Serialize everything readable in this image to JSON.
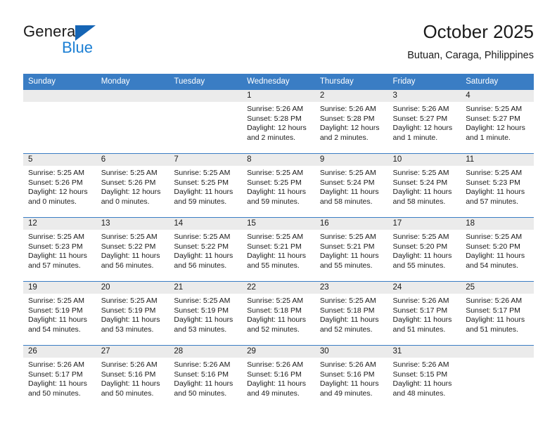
{
  "brand": {
    "line1": "General",
    "line2": "Blue",
    "triangle_color": "#1565b5",
    "blue_color": "#1b7fd4"
  },
  "header": {
    "title": "October 2025",
    "subtitle": "Butuan, Caraga, Philippines"
  },
  "theme": {
    "header_bg": "#3a7dc4",
    "daynum_bg": "#ebebeb",
    "text": "#1a1a1a"
  },
  "calendar": {
    "weekday_headers": [
      "Sunday",
      "Monday",
      "Tuesday",
      "Wednesday",
      "Thursday",
      "Friday",
      "Saturday"
    ],
    "weeks": [
      [
        {
          "day": "",
          "sunrise": "",
          "sunset": "",
          "daylight1": "",
          "daylight2": ""
        },
        {
          "day": "",
          "sunrise": "",
          "sunset": "",
          "daylight1": "",
          "daylight2": ""
        },
        {
          "day": "",
          "sunrise": "",
          "sunset": "",
          "daylight1": "",
          "daylight2": ""
        },
        {
          "day": "1",
          "sunrise": "Sunrise: 5:26 AM",
          "sunset": "Sunset: 5:28 PM",
          "daylight1": "Daylight: 12 hours",
          "daylight2": "and 2 minutes."
        },
        {
          "day": "2",
          "sunrise": "Sunrise: 5:26 AM",
          "sunset": "Sunset: 5:28 PM",
          "daylight1": "Daylight: 12 hours",
          "daylight2": "and 2 minutes."
        },
        {
          "day": "3",
          "sunrise": "Sunrise: 5:26 AM",
          "sunset": "Sunset: 5:27 PM",
          "daylight1": "Daylight: 12 hours",
          "daylight2": "and 1 minute."
        },
        {
          "day": "4",
          "sunrise": "Sunrise: 5:25 AM",
          "sunset": "Sunset: 5:27 PM",
          "daylight1": "Daylight: 12 hours",
          "daylight2": "and 1 minute."
        }
      ],
      [
        {
          "day": "5",
          "sunrise": "Sunrise: 5:25 AM",
          "sunset": "Sunset: 5:26 PM",
          "daylight1": "Daylight: 12 hours",
          "daylight2": "and 0 minutes."
        },
        {
          "day": "6",
          "sunrise": "Sunrise: 5:25 AM",
          "sunset": "Sunset: 5:26 PM",
          "daylight1": "Daylight: 12 hours",
          "daylight2": "and 0 minutes."
        },
        {
          "day": "7",
          "sunrise": "Sunrise: 5:25 AM",
          "sunset": "Sunset: 5:25 PM",
          "daylight1": "Daylight: 11 hours",
          "daylight2": "and 59 minutes."
        },
        {
          "day": "8",
          "sunrise": "Sunrise: 5:25 AM",
          "sunset": "Sunset: 5:25 PM",
          "daylight1": "Daylight: 11 hours",
          "daylight2": "and 59 minutes."
        },
        {
          "day": "9",
          "sunrise": "Sunrise: 5:25 AM",
          "sunset": "Sunset: 5:24 PM",
          "daylight1": "Daylight: 11 hours",
          "daylight2": "and 58 minutes."
        },
        {
          "day": "10",
          "sunrise": "Sunrise: 5:25 AM",
          "sunset": "Sunset: 5:24 PM",
          "daylight1": "Daylight: 11 hours",
          "daylight2": "and 58 minutes."
        },
        {
          "day": "11",
          "sunrise": "Sunrise: 5:25 AM",
          "sunset": "Sunset: 5:23 PM",
          "daylight1": "Daylight: 11 hours",
          "daylight2": "and 57 minutes."
        }
      ],
      [
        {
          "day": "12",
          "sunrise": "Sunrise: 5:25 AM",
          "sunset": "Sunset: 5:23 PM",
          "daylight1": "Daylight: 11 hours",
          "daylight2": "and 57 minutes."
        },
        {
          "day": "13",
          "sunrise": "Sunrise: 5:25 AM",
          "sunset": "Sunset: 5:22 PM",
          "daylight1": "Daylight: 11 hours",
          "daylight2": "and 56 minutes."
        },
        {
          "day": "14",
          "sunrise": "Sunrise: 5:25 AM",
          "sunset": "Sunset: 5:22 PM",
          "daylight1": "Daylight: 11 hours",
          "daylight2": "and 56 minutes."
        },
        {
          "day": "15",
          "sunrise": "Sunrise: 5:25 AM",
          "sunset": "Sunset: 5:21 PM",
          "daylight1": "Daylight: 11 hours",
          "daylight2": "and 55 minutes."
        },
        {
          "day": "16",
          "sunrise": "Sunrise: 5:25 AM",
          "sunset": "Sunset: 5:21 PM",
          "daylight1": "Daylight: 11 hours",
          "daylight2": "and 55 minutes."
        },
        {
          "day": "17",
          "sunrise": "Sunrise: 5:25 AM",
          "sunset": "Sunset: 5:20 PM",
          "daylight1": "Daylight: 11 hours",
          "daylight2": "and 55 minutes."
        },
        {
          "day": "18",
          "sunrise": "Sunrise: 5:25 AM",
          "sunset": "Sunset: 5:20 PM",
          "daylight1": "Daylight: 11 hours",
          "daylight2": "and 54 minutes."
        }
      ],
      [
        {
          "day": "19",
          "sunrise": "Sunrise: 5:25 AM",
          "sunset": "Sunset: 5:19 PM",
          "daylight1": "Daylight: 11 hours",
          "daylight2": "and 54 minutes."
        },
        {
          "day": "20",
          "sunrise": "Sunrise: 5:25 AM",
          "sunset": "Sunset: 5:19 PM",
          "daylight1": "Daylight: 11 hours",
          "daylight2": "and 53 minutes."
        },
        {
          "day": "21",
          "sunrise": "Sunrise: 5:25 AM",
          "sunset": "Sunset: 5:19 PM",
          "daylight1": "Daylight: 11 hours",
          "daylight2": "and 53 minutes."
        },
        {
          "day": "22",
          "sunrise": "Sunrise: 5:25 AM",
          "sunset": "Sunset: 5:18 PM",
          "daylight1": "Daylight: 11 hours",
          "daylight2": "and 52 minutes."
        },
        {
          "day": "23",
          "sunrise": "Sunrise: 5:25 AM",
          "sunset": "Sunset: 5:18 PM",
          "daylight1": "Daylight: 11 hours",
          "daylight2": "and 52 minutes."
        },
        {
          "day": "24",
          "sunrise": "Sunrise: 5:26 AM",
          "sunset": "Sunset: 5:17 PM",
          "daylight1": "Daylight: 11 hours",
          "daylight2": "and 51 minutes."
        },
        {
          "day": "25",
          "sunrise": "Sunrise: 5:26 AM",
          "sunset": "Sunset: 5:17 PM",
          "daylight1": "Daylight: 11 hours",
          "daylight2": "and 51 minutes."
        }
      ],
      [
        {
          "day": "26",
          "sunrise": "Sunrise: 5:26 AM",
          "sunset": "Sunset: 5:17 PM",
          "daylight1": "Daylight: 11 hours",
          "daylight2": "and 50 minutes."
        },
        {
          "day": "27",
          "sunrise": "Sunrise: 5:26 AM",
          "sunset": "Sunset: 5:16 PM",
          "daylight1": "Daylight: 11 hours",
          "daylight2": "and 50 minutes."
        },
        {
          "day": "28",
          "sunrise": "Sunrise: 5:26 AM",
          "sunset": "Sunset: 5:16 PM",
          "daylight1": "Daylight: 11 hours",
          "daylight2": "and 50 minutes."
        },
        {
          "day": "29",
          "sunrise": "Sunrise: 5:26 AM",
          "sunset": "Sunset: 5:16 PM",
          "daylight1": "Daylight: 11 hours",
          "daylight2": "and 49 minutes."
        },
        {
          "day": "30",
          "sunrise": "Sunrise: 5:26 AM",
          "sunset": "Sunset: 5:16 PM",
          "daylight1": "Daylight: 11 hours",
          "daylight2": "and 49 minutes."
        },
        {
          "day": "31",
          "sunrise": "Sunrise: 5:26 AM",
          "sunset": "Sunset: 5:15 PM",
          "daylight1": "Daylight: 11 hours",
          "daylight2": "and 48 minutes."
        },
        {
          "day": "",
          "sunrise": "",
          "sunset": "",
          "daylight1": "",
          "daylight2": ""
        }
      ]
    ]
  }
}
